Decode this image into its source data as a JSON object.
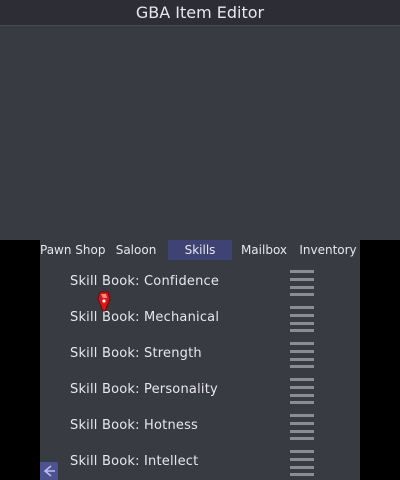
{
  "app": {
    "title": "GBA Item Editor"
  },
  "tabs": [
    {
      "label": "Pawn Shop",
      "active": false
    },
    {
      "label": "Saloon",
      "active": false
    },
    {
      "label": "Skills",
      "active": true
    },
    {
      "label": "Mailbox",
      "active": false
    },
    {
      "label": "Inventory",
      "active": false
    }
  ],
  "items": [
    {
      "label": "Skill Book: Confidence"
    },
    {
      "label": "Skill Book: Mechanical"
    },
    {
      "label": "Skill Book: Strength"
    },
    {
      "label": "Skill Book: Personality"
    },
    {
      "label": "Skill Book: Hotness"
    },
    {
      "label": "Skill Book: Intellect"
    }
  ],
  "icons": {
    "drag_handle": "hamburger-drag-icon",
    "cursor": "pointer-cursor-icon",
    "back": "back-arrow-icon"
  },
  "colors": {
    "background": "#383b42",
    "title_bar": "#2c2d35",
    "active_tab": "#3f4374",
    "text": "#e8e8ec",
    "handle": "#8a8d96",
    "cursor": "#d81818",
    "back_button": "#4d5290"
  }
}
